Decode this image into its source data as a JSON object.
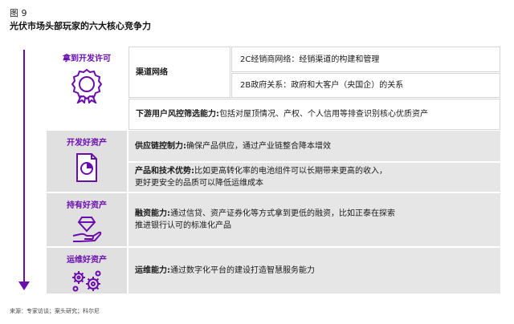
{
  "figure": {
    "label": "图 9",
    "title": "光伏市场头部玩家的六大核心竞争力"
  },
  "stages": [
    {
      "title": "拿到开发许可",
      "icon": "award-ribbon-icon"
    },
    {
      "title": "开发好资产",
      "icon": "document-chart-icon"
    },
    {
      "title": "持有好资产",
      "icon": "diamond-hand-icon"
    },
    {
      "title": "运维好资产",
      "icon": "gears-icon"
    }
  ],
  "rows": {
    "channel": {
      "label": "渠道网络",
      "sub1": "2C经销商网络：经销渠道的构建和管理",
      "sub2": "2B政府关系：政府和大客户（央国企）的关系"
    },
    "risk": {
      "label": "下游用户风控筛选能力:",
      "desc": "包括对屋顶情况、产权、个人信用等排查识别核心优质资产"
    },
    "supply": {
      "label": "供应链控制力:",
      "desc": "确保产品供应，通过产业链整合降本增效"
    },
    "tech": {
      "label": "产品和技术优势:",
      "desc": "比如更高转化率的电池组件可以长期带来更高的收入，",
      "desc2": "更好更安全的品质可以降低运维成本"
    },
    "finance": {
      "label": "融资能力:",
      "desc": "通过信贷、资产证券化等方式拿到更低的融资，比如正泰在探索",
      "desc2": "推进银行认可的标准化产品"
    },
    "ops": {
      "label": "运维能力:",
      "desc": "通过数字化平台的建设打造智慧服务能力"
    }
  },
  "source": "来源：专家访谈；案头研究；科尔尼",
  "colors": {
    "accent": "#6a0dad",
    "grey_fill": "#e0e0e0",
    "border": "#d6d6d6"
  }
}
